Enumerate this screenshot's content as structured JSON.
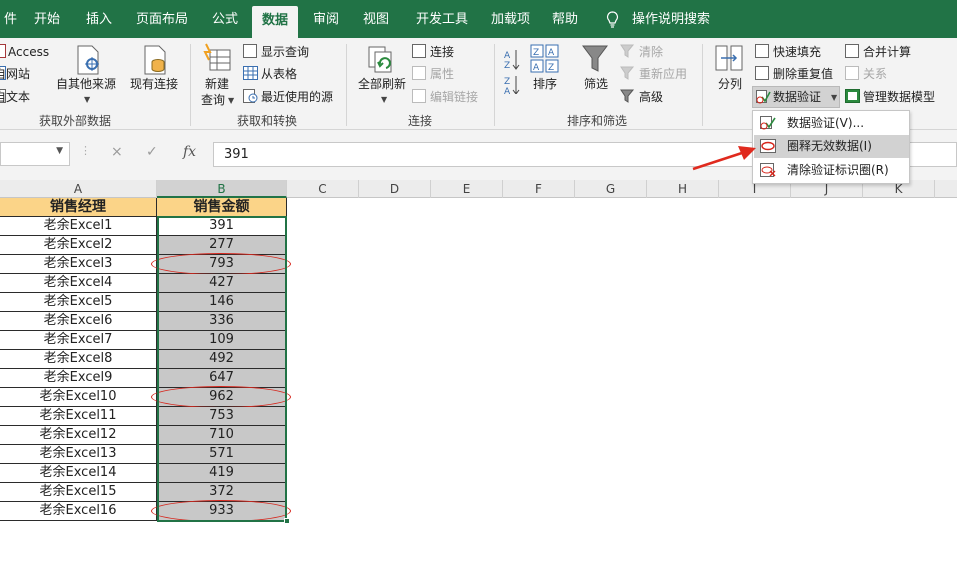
{
  "tabs": [
    {
      "label": "件"
    },
    {
      "label": "开始"
    },
    {
      "label": "插入"
    },
    {
      "label": "页面布局"
    },
    {
      "label": "公式"
    },
    {
      "label": "数据"
    },
    {
      "label": "审阅"
    },
    {
      "label": "视图"
    },
    {
      "label": "开发工具"
    },
    {
      "label": "加载项"
    },
    {
      "label": "帮助"
    },
    {
      "label": "操作说明搜索"
    }
  ],
  "ribbon": {
    "get_external": {
      "access": "Access",
      "web": "自网站",
      "text": "自文本",
      "other_sources": "自其他来源",
      "existing": "现有连接",
      "group_label": "获取外部数据"
    },
    "get_transform": {
      "new_query_1": "新建",
      "new_query_2": "查询",
      "show_queries": "显示查询",
      "from_table": "从表格",
      "recent_sources": "最近使用的源",
      "group_label": "获取和转换"
    },
    "connections": {
      "refresh_all": "全部刷新",
      "connections": "连接",
      "properties": "属性",
      "edit_links": "编辑链接",
      "group_label": "连接"
    },
    "sort_filter": {
      "sort": "排序",
      "filter": "筛选",
      "clear": "清除",
      "reapply": "重新应用",
      "advanced": "高级",
      "group_label": "排序和筛选"
    },
    "data_tools": {
      "text_to_columns": "分列",
      "flash_fill": "快速填充",
      "remove_duplicates": "删除重复值",
      "data_validation": "数据验证",
      "consolidate": "合并计算",
      "relationships": "关系",
      "manage_data_model": "管理数据模型"
    }
  },
  "formula_bar": {
    "name_box": "",
    "cancel": "×",
    "enter": "✓",
    "fx": "fx",
    "value": "391"
  },
  "columns": [
    "A",
    "B",
    "C",
    "D",
    "E",
    "F",
    "G",
    "H",
    "I",
    "J",
    "K"
  ],
  "table": {
    "headers": [
      "销售经理",
      "销售金额"
    ],
    "rows": [
      {
        "name": "老余Excel1",
        "amount": "391",
        "circled": false
      },
      {
        "name": "老余Excel2",
        "amount": "277",
        "circled": false
      },
      {
        "name": "老余Excel3",
        "amount": "793",
        "circled": true
      },
      {
        "name": "老余Excel4",
        "amount": "427",
        "circled": false
      },
      {
        "name": "老余Excel5",
        "amount": "146",
        "circled": false
      },
      {
        "name": "老余Excel6",
        "amount": "336",
        "circled": false
      },
      {
        "name": "老余Excel7",
        "amount": "109",
        "circled": false
      },
      {
        "name": "老余Excel8",
        "amount": "492",
        "circled": false
      },
      {
        "name": "老余Excel9",
        "amount": "647",
        "circled": false
      },
      {
        "name": "老余Excel10",
        "amount": "962",
        "circled": true
      },
      {
        "name": "老余Excel11",
        "amount": "753",
        "circled": false
      },
      {
        "name": "老余Excel12",
        "amount": "710",
        "circled": false
      },
      {
        "name": "老余Excel13",
        "amount": "571",
        "circled": false
      },
      {
        "name": "老余Excel14",
        "amount": "419",
        "circled": false
      },
      {
        "name": "老余Excel15",
        "amount": "372",
        "circled": false
      },
      {
        "name": "老余Excel16",
        "amount": "933",
        "circled": true
      }
    ]
  },
  "validation_menu": [
    {
      "label": "数据验证(V)...",
      "icon": "data-validation-icon",
      "highlighted": false
    },
    {
      "label": "圈释无效数据(I)",
      "icon": "circle-invalid-icon",
      "highlighted": true
    },
    {
      "label": "清除验证标识圈(R)",
      "icon": "clear-circles-icon",
      "highlighted": false
    }
  ],
  "colors": {
    "tab_bar": "#217346",
    "header_fill": "#fbd488",
    "selection_fill": "#c8c8c8",
    "circle": "#d6261c"
  }
}
